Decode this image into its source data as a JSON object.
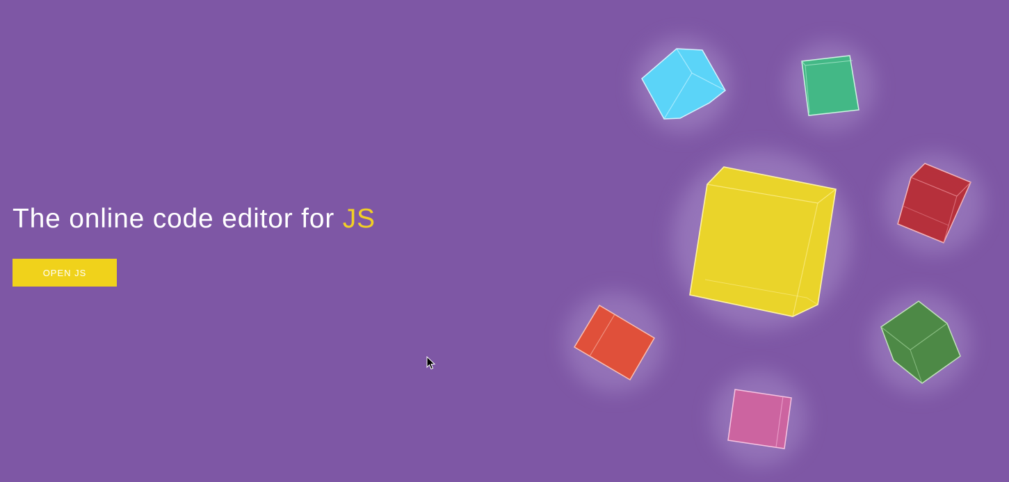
{
  "hero": {
    "headline_prefix": "The online code editor for ",
    "headline_accent": "JS",
    "button_label": "OPEN JS"
  },
  "colors": {
    "background": "#7e57a5",
    "accent": "#f2d024",
    "button": "#f0d21b",
    "text": "#ffffff"
  },
  "decorations": {
    "cubes": [
      {
        "name": "cyan",
        "color": "#5ad8fb"
      },
      {
        "name": "teal",
        "color": "#43b886"
      },
      {
        "name": "yellow",
        "color": "#ead42a"
      },
      {
        "name": "red",
        "color": "#b82e38"
      },
      {
        "name": "orange",
        "color": "#e0503a"
      },
      {
        "name": "green",
        "color": "#4b8a43"
      },
      {
        "name": "pink",
        "color": "#cc64a0"
      }
    ]
  }
}
